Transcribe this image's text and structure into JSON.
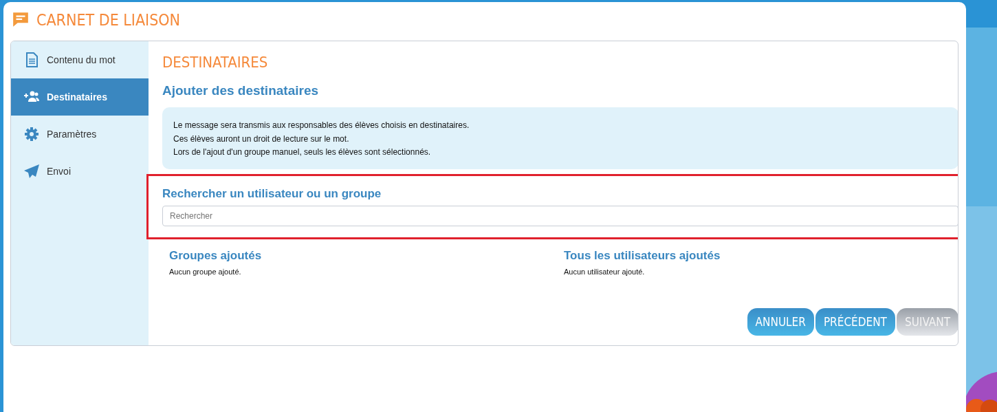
{
  "window": {
    "title": "CARNET DE LIAISON"
  },
  "sidebar": {
    "items": [
      {
        "label": "Contenu du mot",
        "kind": "document",
        "selected": false
      },
      {
        "label": "Destinataires",
        "kind": "recipients",
        "selected": true
      },
      {
        "label": "Paramètres",
        "kind": "settings",
        "selected": false
      },
      {
        "label": "Envoi",
        "kind": "sending",
        "selected": false
      }
    ]
  },
  "main": {
    "heading": "DESTINATAIRES",
    "subheading": "Ajouter des destinataires",
    "info_lines": [
      "Le message sera transmis aux responsables des élèves choisis en destinataires.",
      "Ces élèves auront un droit de lecture sur le mot.",
      "Lors de l'ajout d'un groupe manuel, seuls les élèves sont sélectionnés."
    ],
    "search": {
      "title": "Rechercher un utilisateur ou un groupe",
      "placeholder": "Rechercher",
      "highlighted": true
    },
    "lists": [
      {
        "title": "Groupes ajoutés",
        "empty_text": "Aucun groupe ajouté."
      },
      {
        "title": "Tous les utilisateurs ajoutés",
        "empty_text": "Aucun utilisateur ajouté."
      }
    ],
    "buttons": [
      {
        "label": "ANNULER",
        "disabled": false
      },
      {
        "label": "PRÉCÉDENT",
        "disabled": false
      },
      {
        "label": "SUIVANT",
        "disabled": true
      }
    ]
  }
}
